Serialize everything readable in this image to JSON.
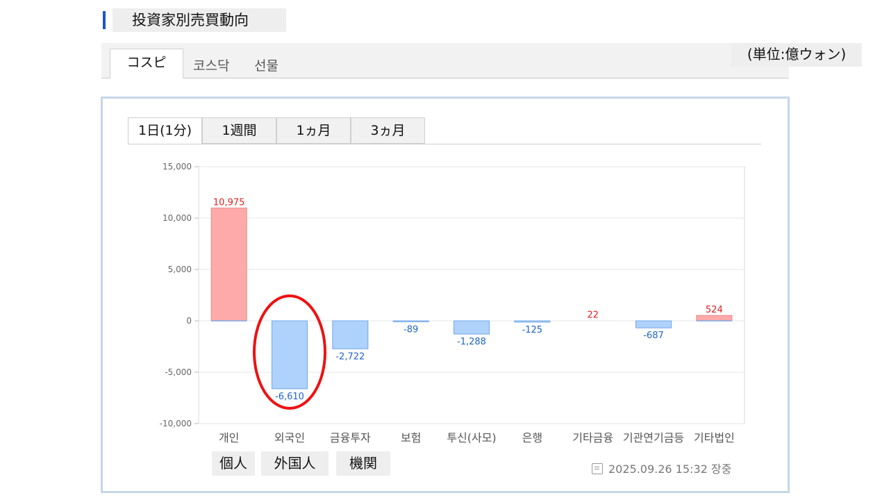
{
  "page": {
    "title": "投資家別売買動向",
    "unit_note": "(単位:億ウォン)",
    "accent": "#1a56c8"
  },
  "market_tabs": [
    "コスピ",
    "코스닥",
    "선물"
  ],
  "period_tabs": [
    "1日(1分)",
    "1週間",
    "1ヵ月",
    "3ヵ月"
  ],
  "timestamp": "2025.09.26 15:32 장중",
  "jp_labels": [
    "個人",
    "外国人",
    "機関"
  ],
  "highlight": {
    "category": "외국인",
    "color": "#ee1111"
  },
  "colors": {
    "positive_fill": "#ffaaaa",
    "positive_stroke": "#e88888",
    "negative_fill": "#aed2fb",
    "negative_stroke": "#6fa6e8",
    "positive_label": "#e02020",
    "negative_label": "#1e63c8"
  },
  "chart_data": {
    "type": "bar",
    "categories": [
      "개인",
      "외국인",
      "금융투자",
      "보험",
      "투신(사모)",
      "은행",
      "기타금융",
      "기관연기금등",
      "기타법인"
    ],
    "values": [
      10975,
      -6610,
      -2722,
      -89,
      -1288,
      -125,
      22,
      -687,
      524
    ],
    "value_labels": [
      "10,975",
      "-6,610",
      "-2,722",
      "-89",
      "-1,288",
      "-125",
      "22",
      "-687",
      "524"
    ],
    "yticks": [
      "15,000",
      "10,000",
      "5,000",
      "0",
      "-5,000",
      "-10,000"
    ],
    "ytick_values": [
      15000,
      10000,
      5000,
      0,
      -5000,
      -10000
    ],
    "ylim": [
      -10000,
      15000
    ],
    "grid": true
  }
}
